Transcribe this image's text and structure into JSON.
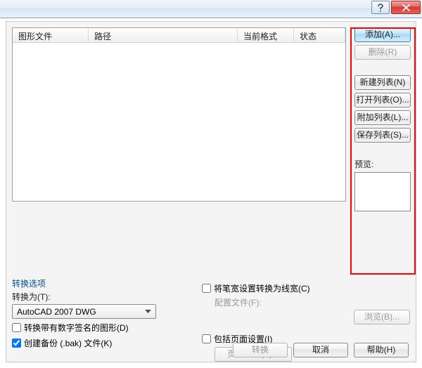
{
  "titlebar": {
    "help_hint": "?",
    "close_hint": "x"
  },
  "table": {
    "columns": [
      "图形文件",
      "路径",
      "当前格式",
      "状态"
    ]
  },
  "side": {
    "add": "添加(A)...",
    "remove": "删除(R)",
    "new_list": "新建列表(N)",
    "open_list": "打开列表(O)...",
    "append_list": "附加列表(L)...",
    "save_list": "保存列表(S)...",
    "preview_label": "预览:"
  },
  "options": {
    "group_title": "转换选项",
    "convert_to_label": "转换为(T):",
    "combo_value": "AutoCAD 2007 DWG",
    "chk_signed": "转换带有数字签名的图形(D)",
    "chk_backup": "创建备份 (.bak) 文件(K)",
    "chk_linewidth": "将笔宽设置转换为线宽(C)",
    "config_file_label": "配置文件(F):",
    "browse": "浏览(B)...",
    "chk_pagesetup": "包括页面设置(I)",
    "page_setup_btn": "页面设置(P)..."
  },
  "footer": {
    "convert": "转换",
    "cancel": "取消",
    "help": "帮助(H)"
  }
}
